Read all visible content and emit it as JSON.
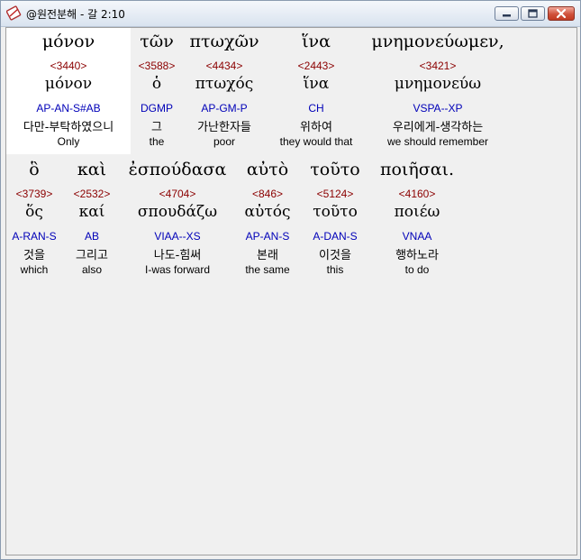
{
  "window": {
    "title": "@원전분해 - 갈 2:10"
  },
  "rows": [
    {
      "words": [
        {
          "greek": "μόνον",
          "strong": "<3440>",
          "lemma": "μόνον",
          "parse": "AP-AN-S#AB",
          "korean": "다만-부탁하였으니",
          "english": "Only",
          "selected": true
        },
        {
          "greek": "τῶν",
          "strong": "<3588>",
          "lemma": "ὁ",
          "parse": "DGMP",
          "korean": "그",
          "english": "the",
          "selected": false
        },
        {
          "greek": "πτωχῶν",
          "strong": "<4434>",
          "lemma": "πτωχός",
          "parse": "AP-GM-P",
          "korean": "가난한자들",
          "english": "poor",
          "selected": false
        },
        {
          "greek": "ἵνα",
          "strong": "<2443>",
          "lemma": "ἵνα",
          "parse": "CH",
          "korean": "위하여",
          "english": "they would that",
          "selected": false
        },
        {
          "greek": "μνημονεύωμεν,",
          "strong": "<3421>",
          "lemma": "μνημονεύω",
          "parse": "VSPA--XP",
          "korean": "우리에게-생각하는",
          "english": "we should remember",
          "selected": false
        }
      ]
    },
    {
      "words": [
        {
          "greek": "ὃ",
          "strong": "<3739>",
          "lemma": "ὅς",
          "parse": "A-RAN-S",
          "korean": "것을",
          "english": "which",
          "selected": false
        },
        {
          "greek": "καὶ",
          "strong": "<2532>",
          "lemma": "καί",
          "parse": "AB",
          "korean": "그리고",
          "english": "also",
          "selected": false
        },
        {
          "greek": "ἐσπούδασα",
          "strong": "<4704>",
          "lemma": "σπουδάζω",
          "parse": "VIAA--XS",
          "korean": "나도-힘써",
          "english": "I-was forward",
          "selected": false
        },
        {
          "greek": "αὐτὸ",
          "strong": "<846>",
          "lemma": "αὐτός",
          "parse": "AP-AN-S",
          "korean": "본래",
          "english": "the same",
          "selected": false
        },
        {
          "greek": "τοῦτο",
          "strong": "<5124>",
          "lemma": "τοῦτο",
          "parse": "A-DAN-S",
          "korean": "이것을",
          "english": "this",
          "selected": false
        },
        {
          "greek": "ποιῆσαι.",
          "strong": "<4160>",
          "lemma": "ποιέω",
          "parse": "VNAA",
          "korean": "행하노라",
          "english": "to do",
          "selected": false
        }
      ]
    }
  ]
}
